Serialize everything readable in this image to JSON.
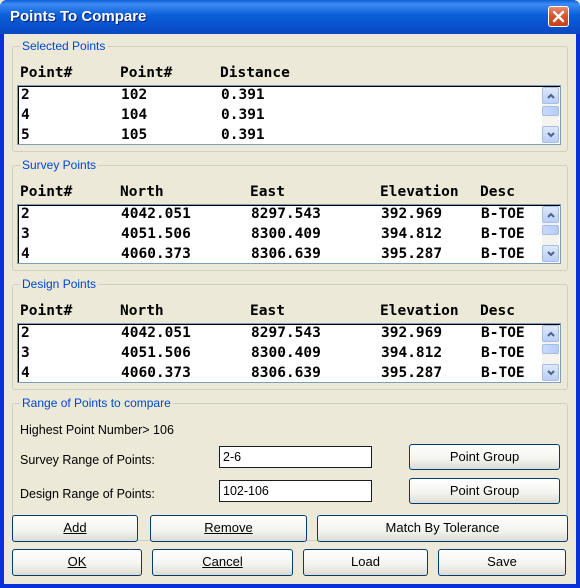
{
  "window": {
    "title": "Points To Compare"
  },
  "selected": {
    "legend": "Selected Points",
    "headers": [
      "Point#",
      "Point#",
      "Distance"
    ],
    "rows": [
      [
        "2",
        "102",
        "0.391"
      ],
      [
        "4",
        "104",
        "0.391"
      ],
      [
        "5",
        "105",
        "0.391"
      ]
    ]
  },
  "survey": {
    "legend": "Survey Points",
    "headers": [
      "Point#",
      "North",
      "East",
      "Elevation",
      "Desc"
    ],
    "rows": [
      [
        "2",
        "4042.051",
        "8297.543",
        "392.969",
        "B-TOE"
      ],
      [
        "3",
        "4051.506",
        "8300.409",
        "394.812",
        "B-TOE"
      ],
      [
        "4",
        "4060.373",
        "8306.639",
        "395.287",
        "B-TOE"
      ]
    ]
  },
  "design": {
    "legend": "Design Points",
    "headers": [
      "Point#",
      "North",
      "East",
      "Elevation",
      "Desc"
    ],
    "rows": [
      [
        "2",
        "4042.051",
        "8297.543",
        "392.969",
        "B-TOE"
      ],
      [
        "3",
        "4051.506",
        "8300.409",
        "394.812",
        "B-TOE"
      ],
      [
        "4",
        "4060.373",
        "8306.639",
        "395.287",
        "B-TOE"
      ]
    ]
  },
  "range": {
    "legend": "Range of Points to compare",
    "highest_label": "Highest Point Number> 106",
    "survey_label": "Survey Range of Points:",
    "survey_value": "2-6",
    "design_label": "Design Range of Points:",
    "design_value": "102-106",
    "point_group_1": "Point Group",
    "point_group_2": "Point Group"
  },
  "buttons": {
    "add": "Add",
    "remove": "Remove",
    "match": "Match By Tolerance",
    "ok": "OK",
    "cancel": "Cancel",
    "load": "Load",
    "save": "Save"
  }
}
